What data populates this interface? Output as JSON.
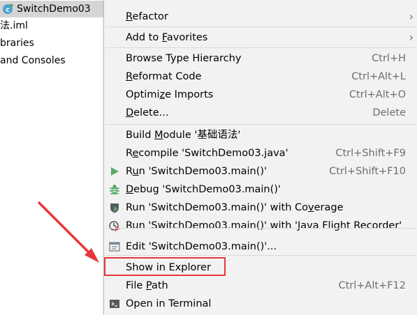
{
  "tree": {
    "items": [
      {
        "label": "SwitchDemo03",
        "icon": "java-class-icon",
        "selected": true
      },
      {
        "label": "法.iml",
        "icon": "",
        "selected": false
      },
      {
        "label": "braries",
        "icon": "",
        "selected": false
      },
      {
        "label": "and Consoles",
        "icon": "",
        "selected": false
      }
    ]
  },
  "menu": {
    "items": [
      {
        "label": "Refactor",
        "mnemonic_index": 0,
        "shortcut": "",
        "submenu": true,
        "icon": ""
      },
      {
        "label": "Add to Favorites",
        "mnemonic_index": 9,
        "shortcut": "",
        "submenu": true,
        "icon": ""
      },
      {
        "label": "Browse Type Hierarchy",
        "mnemonic_index": -1,
        "shortcut": "Ctrl+H",
        "submenu": false,
        "icon": ""
      },
      {
        "label": "Reformat Code",
        "mnemonic_index": 0,
        "shortcut": "Ctrl+Alt+L",
        "submenu": false,
        "icon": ""
      },
      {
        "label": "Optimize Imports",
        "mnemonic_index": 6,
        "shortcut": "Ctrl+Alt+O",
        "submenu": false,
        "icon": ""
      },
      {
        "label": "Delete...",
        "mnemonic_index": 0,
        "shortcut": "Delete",
        "submenu": false,
        "icon": ""
      },
      {
        "label": "Build Module '基础语法'",
        "mnemonic_index": 6,
        "shortcut": "",
        "submenu": false,
        "icon": ""
      },
      {
        "label": "Recompile 'SwitchDemo03.java'",
        "mnemonic_index": 1,
        "shortcut": "Ctrl+Shift+F9",
        "submenu": false,
        "icon": ""
      },
      {
        "label": "Run 'SwitchDemo03.main()'",
        "mnemonic_index": 1,
        "shortcut": "Ctrl+Shift+F10",
        "submenu": false,
        "icon": "run-icon"
      },
      {
        "label": "Debug 'SwitchDemo03.main()'",
        "mnemonic_index": 0,
        "shortcut": "",
        "submenu": false,
        "icon": "debug-icon"
      },
      {
        "label": "Run 'SwitchDemo03.main()' with Coverage",
        "mnemonic_index": 33,
        "shortcut": "",
        "submenu": false,
        "icon": "coverage-icon"
      },
      {
        "label": "Run 'SwitchDemo03.main()' with 'Java Flight Recorder'",
        "mnemonic_index": -1,
        "shortcut": "",
        "submenu": false,
        "icon": "profiler-icon"
      },
      {
        "label": "Edit 'SwitchDemo03.main()'...",
        "mnemonic_index": -1,
        "shortcut": "",
        "submenu": false,
        "icon": "edit-config-icon"
      },
      {
        "label": "Show in Explorer",
        "mnemonic_index": -1,
        "shortcut": "",
        "submenu": false,
        "icon": ""
      },
      {
        "label": "File Path",
        "mnemonic_index": 6,
        "shortcut": "Ctrl+Alt+F12",
        "submenu": false,
        "icon": ""
      },
      {
        "label": "Open in Terminal",
        "mnemonic_index": -1,
        "shortcut": "",
        "submenu": false,
        "icon": "terminal-icon"
      }
    ]
  },
  "colors": {
    "menu_bg": "#f2f2f2",
    "selection_bg": "#d5d5d5",
    "annotation_red": "#e8363a",
    "run_green": "#59a869",
    "shortcut_gray": "#6e6e6e"
  }
}
